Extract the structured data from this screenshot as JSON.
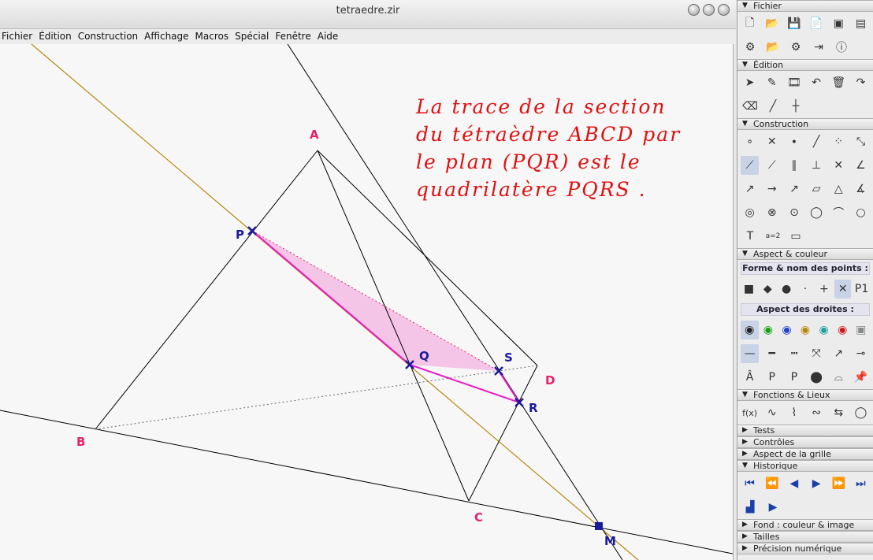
{
  "window": {
    "title": "tetraedre.zir"
  },
  "menu": [
    "Fichier",
    "Édition",
    "Construction",
    "Affichage",
    "Macros",
    "Spécial",
    "Fenêtre",
    "Aide"
  ],
  "note": [
    "La trace de la section",
    "du tétraèdre ABCD par",
    "le plan (PQR) est le",
    "quadrilatère   PQRS ."
  ],
  "points": {
    "A": "A",
    "B": "B",
    "C": "C",
    "D": "D",
    "P": "P",
    "Q": "Q",
    "R": "R",
    "S": "S",
    "M": "M"
  },
  "panel": {
    "fichier": "Fichier",
    "edition": "Édition",
    "construction": "Construction",
    "aspect": "Aspect & couleur",
    "forme_points": "Forme & nom des points :",
    "aspect_droites": "Aspect des droites :",
    "fonctions": "Fonctions & Lieux",
    "tests": "Tests",
    "controles": "Contrôles",
    "grille": "Aspect de la grille",
    "historique": "Historique",
    "fond": "Fond : couleur & image",
    "tailles": "Tailles",
    "precision": "Précision numérique",
    "p1": "P1",
    "text_tool": "T",
    "eq_tool": "a=2"
  },
  "colors": {
    "pink": "#e8206a",
    "blue": "#1a1a9e",
    "note": "#e01010",
    "fill": "#f4bfe6",
    "orange_line": "#b8860b"
  }
}
